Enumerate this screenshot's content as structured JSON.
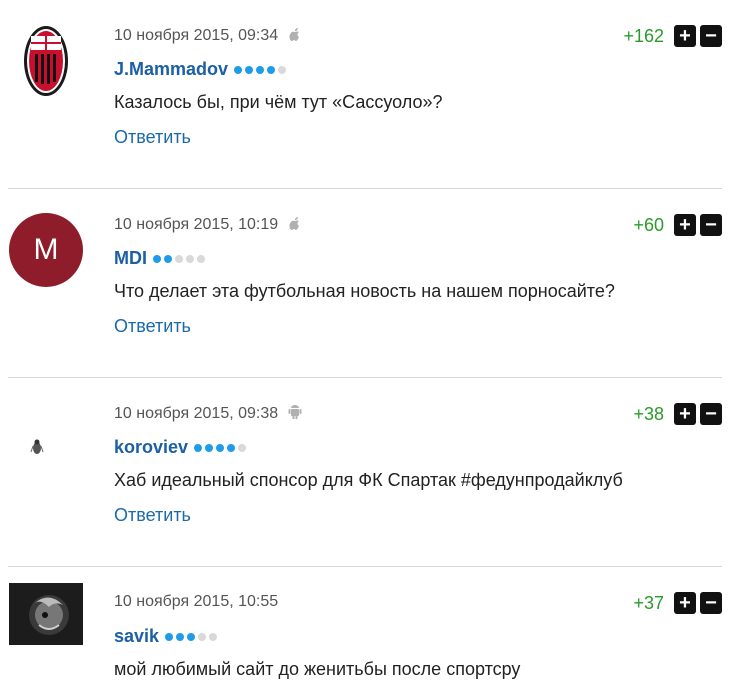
{
  "comments": [
    {
      "date": "10 ноября 2015, 09:34",
      "platform_icon": "apple-icon",
      "username": "J.Mammadov",
      "rating": {
        "filled": 4,
        "total": 5
      },
      "text": "Казалось бы, при чём тут «Сассуоло»?",
      "reply_label": "Ответить",
      "score": "+162",
      "avatar_type": "milan-crest-icon"
    },
    {
      "date": "10 ноября 2015, 10:19",
      "platform_icon": "apple-icon",
      "username": "MDI",
      "rating": {
        "filled": 2,
        "total": 5
      },
      "text": "Что делает эта футбольная новость на нашем порносайте?",
      "reply_label": "Ответить",
      "score": "+60",
      "avatar_letter": "M",
      "avatar_color": "#8e1c2a"
    },
    {
      "date": "10 ноября 2015, 09:38",
      "platform_icon": "android-icon",
      "username": "koroviev",
      "rating": {
        "filled": 4,
        "total": 5
      },
      "text": "Хаб идеальный спонсор для ФК Спартак #федунпродайклуб",
      "reply_label": "Ответить",
      "score": "+38",
      "avatar_type": "small-figure-icon"
    },
    {
      "date": "10 ноября 2015, 10:55",
      "platform_icon": "none",
      "username": "savik",
      "rating": {
        "filled": 3,
        "total": 5
      },
      "text": "мой любимый сайт до женитьбы после спортсру",
      "score": "+37",
      "avatar_type": "dark-photo-icon"
    }
  ],
  "vote_plus": "+",
  "vote_minus": "−",
  "colors": {
    "accent": "#1b5fa5",
    "score": "#2a9b2a",
    "dot_on": "#1f9ce8",
    "dot_off": "#d9d9d9"
  }
}
